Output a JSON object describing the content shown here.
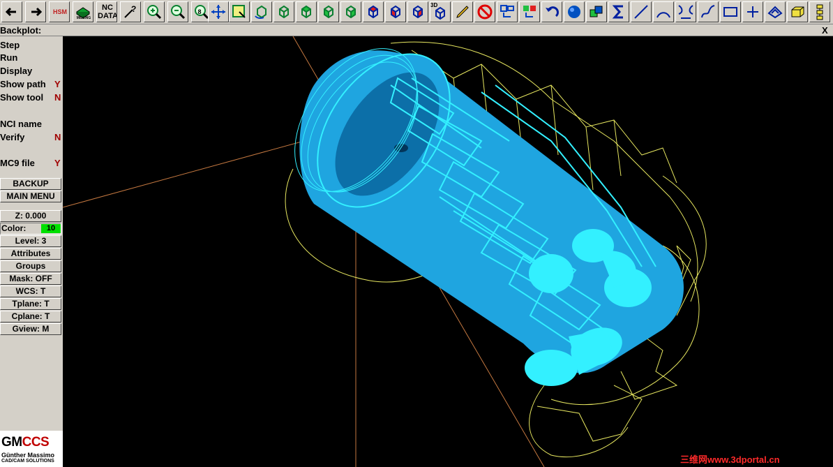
{
  "toolbar": {
    "hsm_label": "HSM",
    "milling_label": "MILLING",
    "ncdata_line1": "NC",
    "ncdata_line2": "DATA",
    "view3d_label": "3D",
    "zoom_level_label": "8"
  },
  "title_bar": {
    "title": "Backplot:",
    "close_label": "X"
  },
  "menu": {
    "step": "Step",
    "run": "Run",
    "display": "Display",
    "show_path": "Show path",
    "show_path_value": "Y",
    "show_tool": "Show tool",
    "show_tool_value": "N",
    "nci_name": "NCI name",
    "verify": "Verify",
    "verify_value": "N",
    "mc9_file": "MC9 file",
    "mc9_file_value": "Y",
    "backup": "BACKUP",
    "main_menu": "MAIN MENU"
  },
  "status": {
    "z": "Z:  0.000",
    "color_label": "Color:",
    "color_value": "10",
    "level": "Level:  3",
    "attributes": "Attributes",
    "groups": "Groups",
    "mask": "Mask:  OFF",
    "wcs": "WCS:  T",
    "tplane": "Tplane:  T",
    "cplane": "Cplane:  T",
    "gview": "Gview:  M"
  },
  "logo": {
    "brand_main": "GM",
    "brand_accent": "CCS",
    "line1": "Günther Massimo",
    "line2": "CAD/CAM SOLUTIONS"
  },
  "watermark": "三维网www.3dportal.cn",
  "colors": {
    "panel": "#d4d0c8",
    "viewport": "#000000",
    "part": "#1fa5e0",
    "toolpath": "#33f0ff",
    "wire": "#e8e860",
    "axis": "#c47840",
    "color_swatch": "#00e000"
  }
}
